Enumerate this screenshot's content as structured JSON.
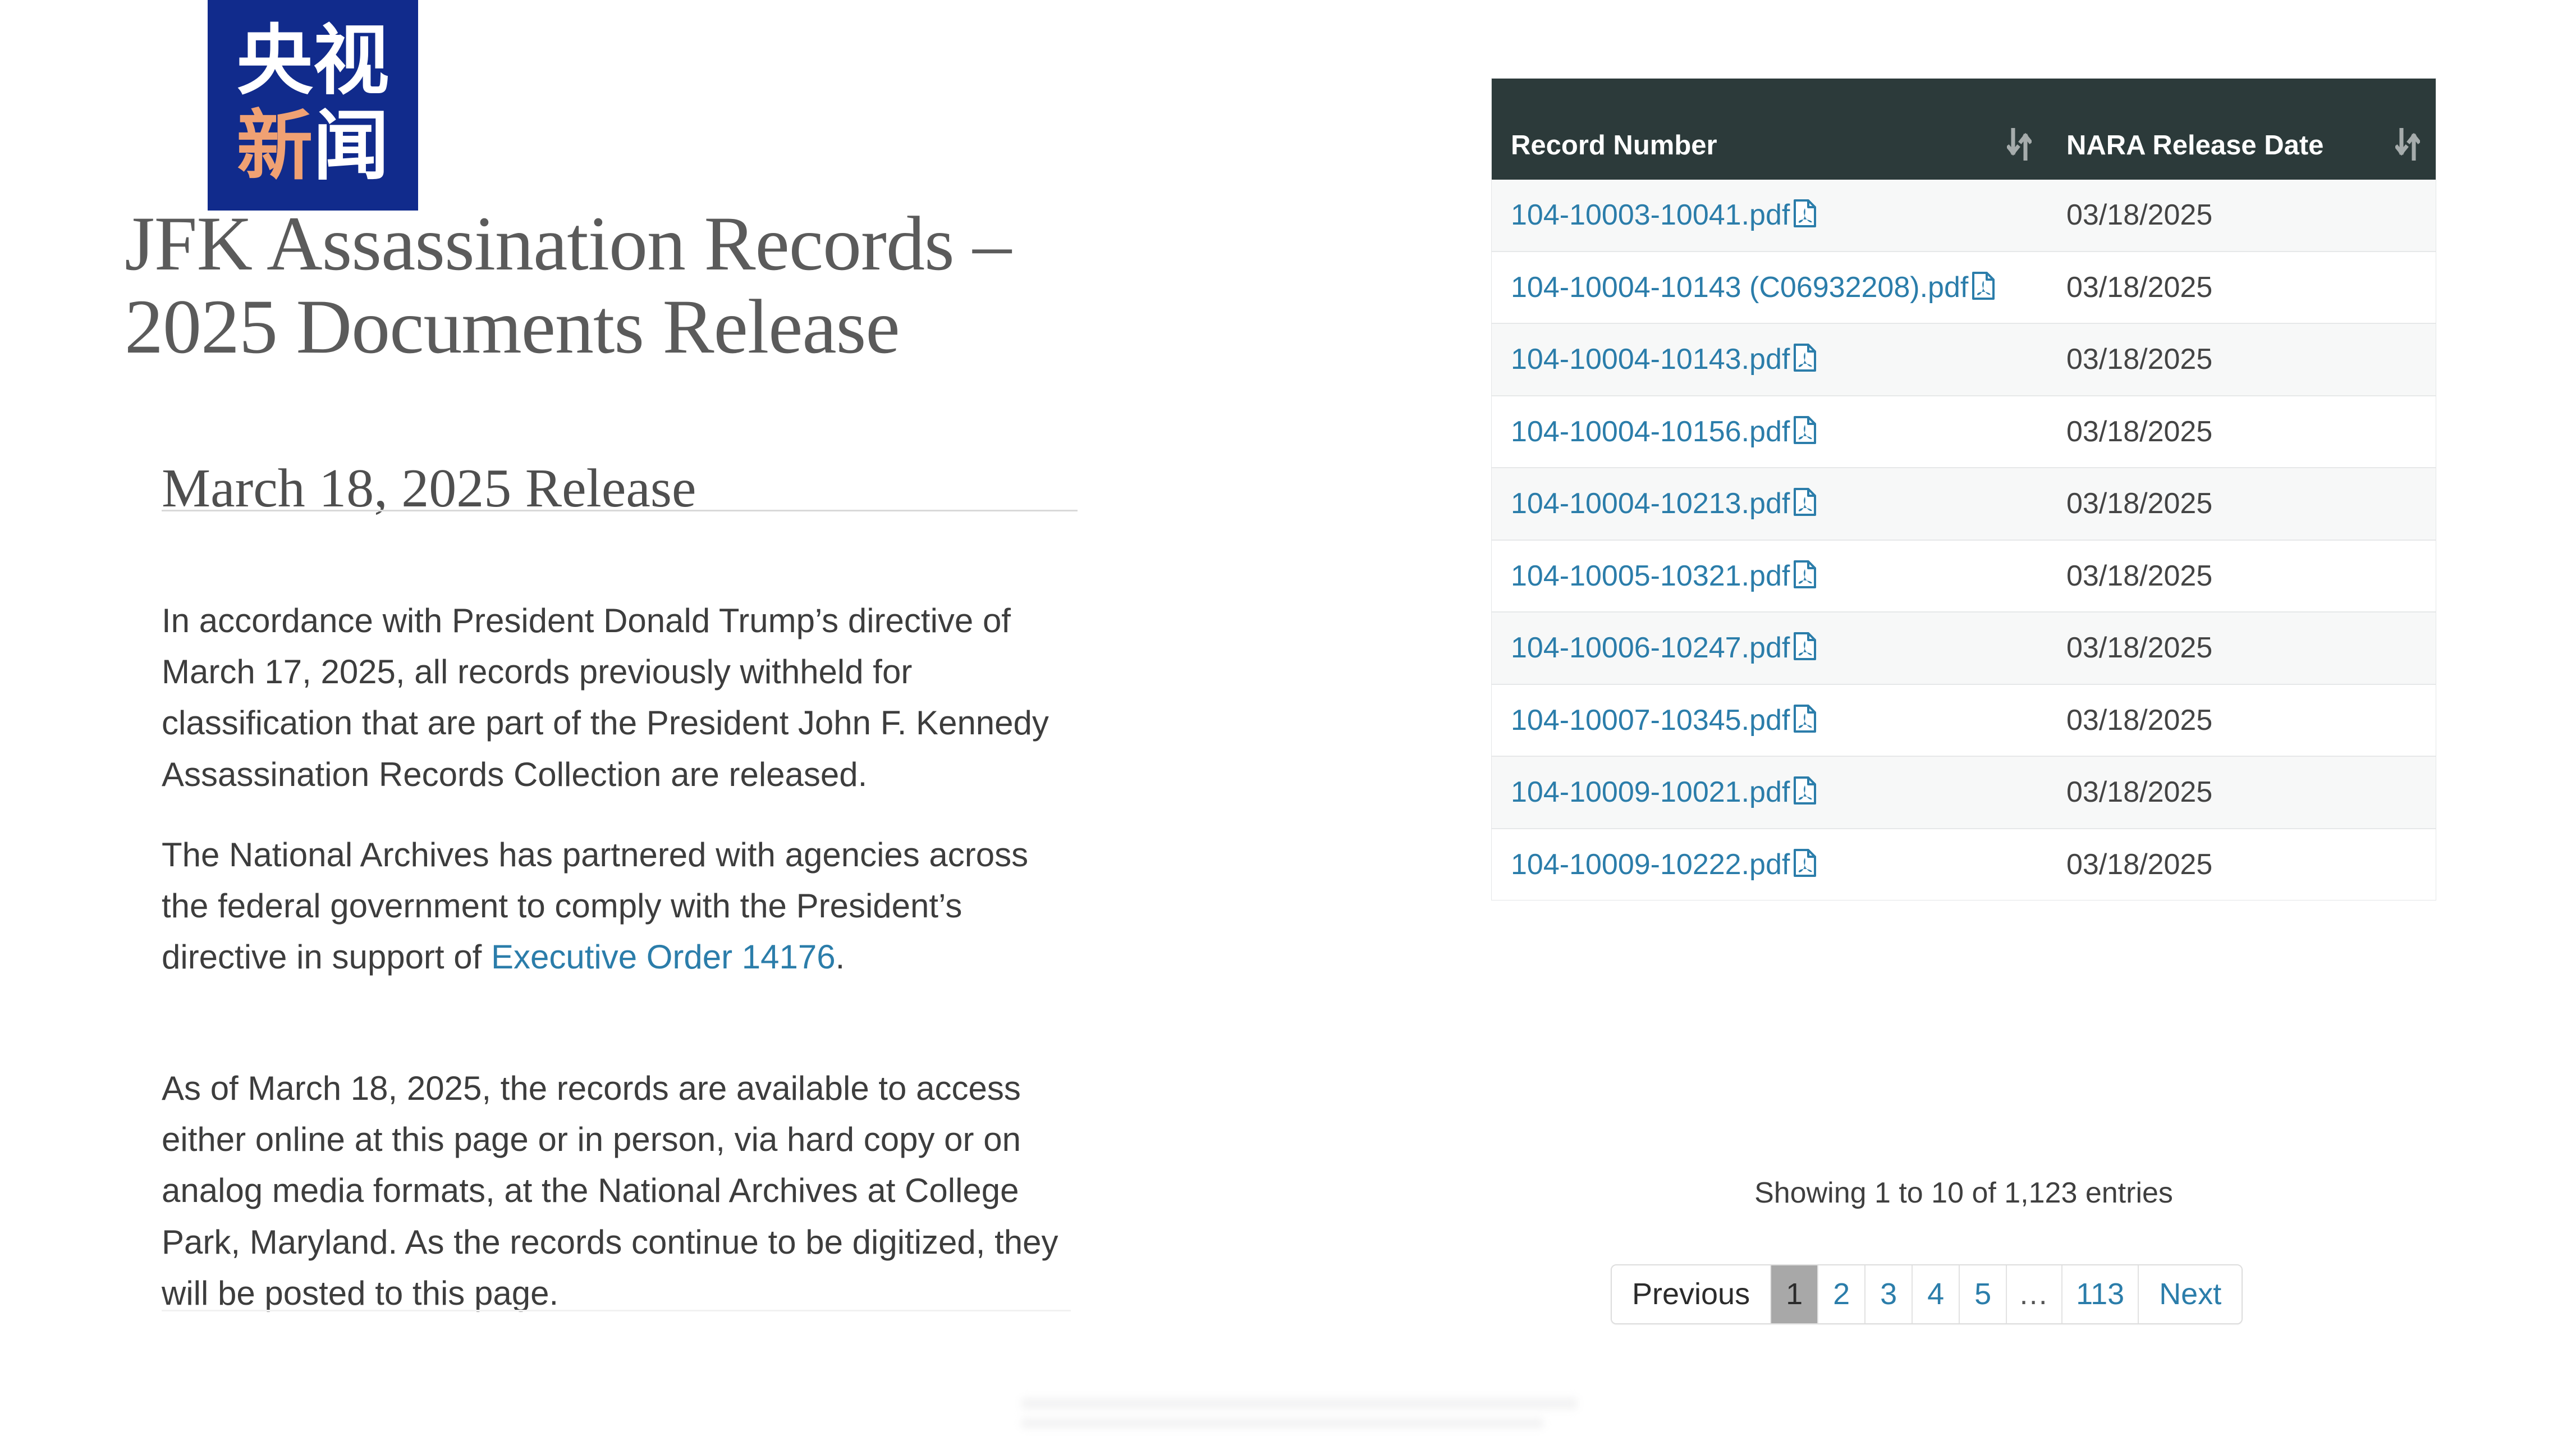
{
  "watermark": {
    "name": "cctv-news-logo",
    "line1": [
      "央",
      "视"
    ],
    "line2": [
      "新",
      "闻"
    ],
    "bg_color": "#112b8c",
    "white_color": "#ffffff",
    "orange_color": "#f0a173"
  },
  "page": {
    "title": "JFK Assassination Records – 2025 Documents Release",
    "release_heading": "March 18, 2025 Release",
    "paragraphs": {
      "p1": "In accordance with President Donald Trump’s directive of March 17, 2025, all records previously withheld for classification that are part of the President John F. Kennedy Assassination Records Collection are released.",
      "p2_before": "The National Archives has partnered with agencies across the federal government to comply with the President’s directive in support of ",
      "p2_link": "Executive Order 14176",
      "p2_after": ".",
      "p3": "As of March 18, 2025, the records are available to access either online at this page or in person, via hard copy or on analog media formats, at the National Archives at College Park, Maryland. As the records continue to be digitized, they will be posted to this page."
    },
    "link_color": "#2b7daa",
    "title_color": "#5b5b5b",
    "body_color": "#3d3d3d"
  },
  "table": {
    "header_bg": "#2c3a3a",
    "columns": [
      {
        "label": "Record Number",
        "sort_icon": "sort-updown-icon"
      },
      {
        "label": "NARA Release Date",
        "sort_icon": "sort-updown-icon"
      }
    ],
    "rows": [
      {
        "record": "104-10003-10041.pdf",
        "date": "03/18/2025"
      },
      {
        "record": "104-10004-10143 (C06932208).pdf",
        "date": "03/18/2025"
      },
      {
        "record": "104-10004-10143.pdf",
        "date": "03/18/2025"
      },
      {
        "record": "104-10004-10156.pdf",
        "date": "03/18/2025"
      },
      {
        "record": "104-10004-10213.pdf",
        "date": "03/18/2025"
      },
      {
        "record": "104-10005-10321.pdf",
        "date": "03/18/2025"
      },
      {
        "record": "104-10006-10247.pdf",
        "date": "03/18/2025"
      },
      {
        "record": "104-10007-10345.pdf",
        "date": "03/18/2025"
      },
      {
        "record": "104-10009-10021.pdf",
        "date": "03/18/2025"
      },
      {
        "record": "104-10009-10222.pdf",
        "date": "03/18/2025"
      }
    ]
  },
  "footer": {
    "showing_entries": "Showing 1 to 10 of 1,123 entries"
  },
  "pagination": {
    "previous": "Previous",
    "pages": [
      "1",
      "2",
      "3",
      "4",
      "5",
      "…",
      "113"
    ],
    "next": "Next",
    "active_page": "1",
    "active_bg": "#a8a8a8"
  }
}
